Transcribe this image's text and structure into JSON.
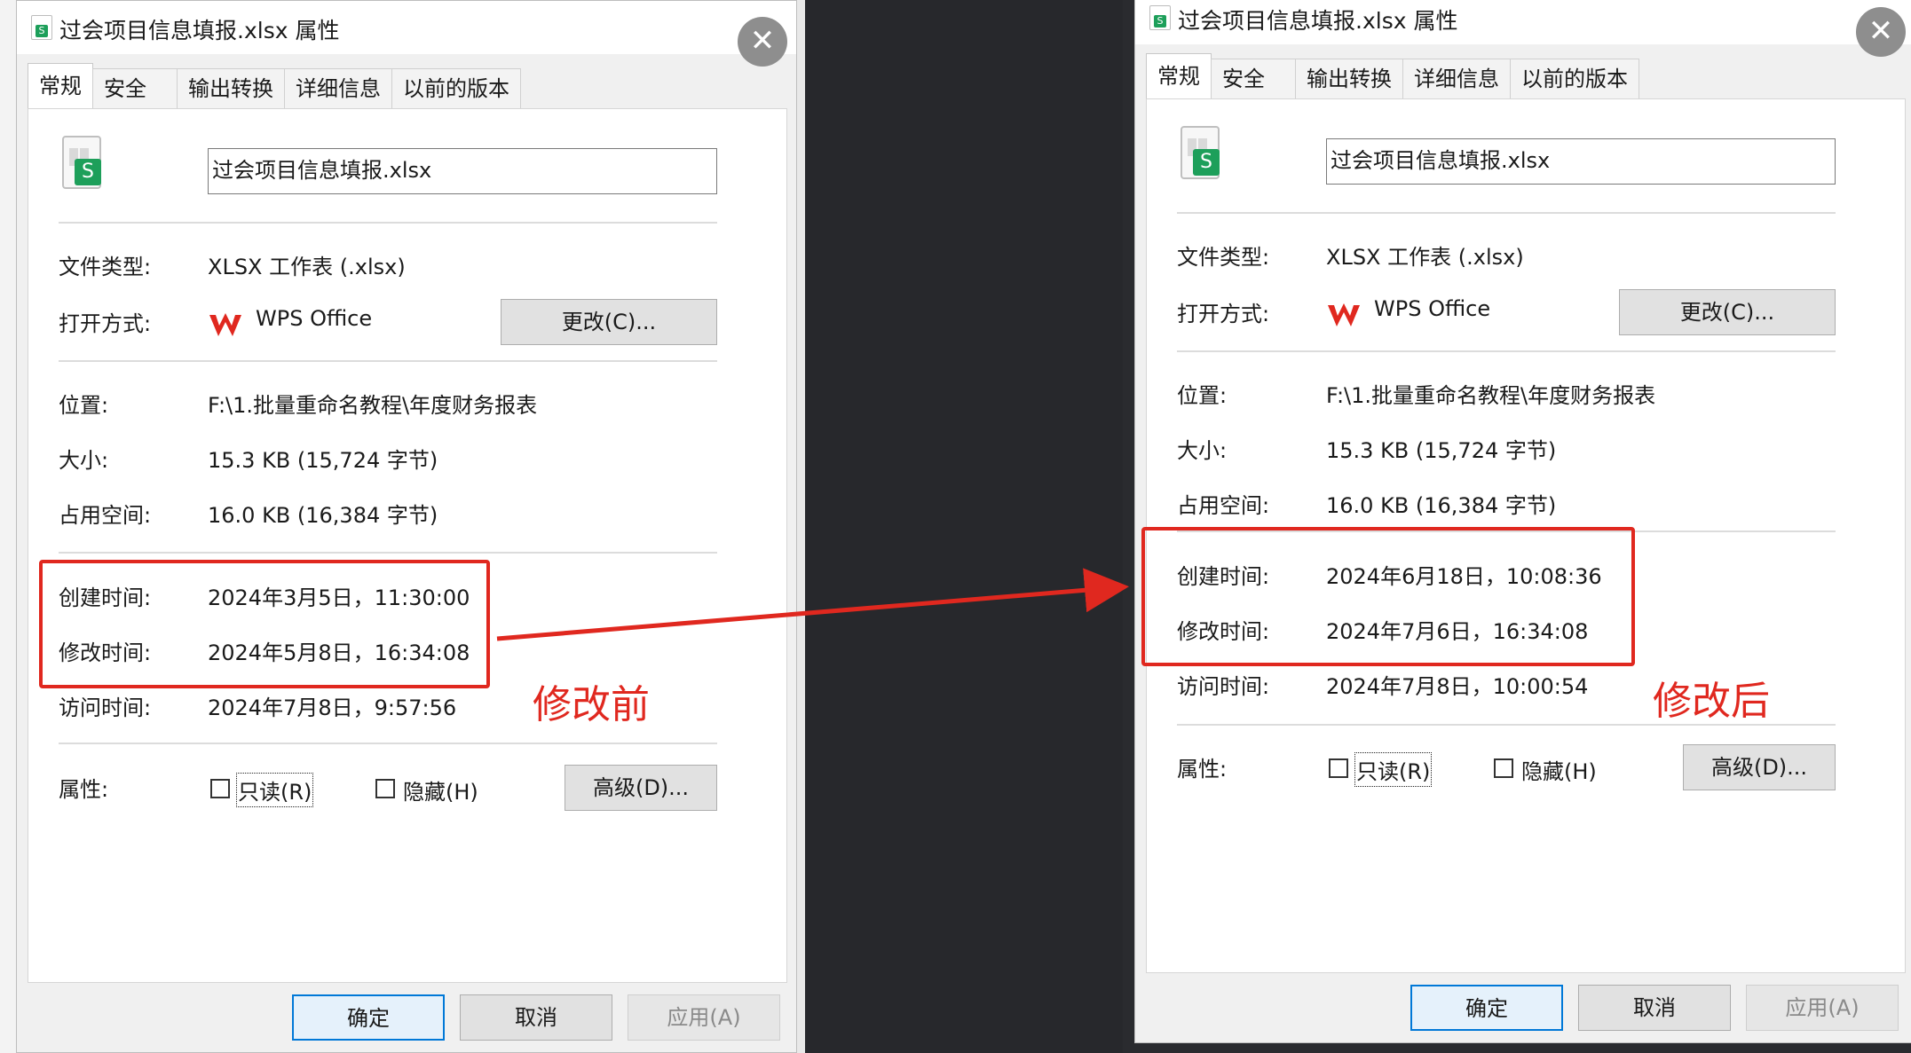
{
  "colors": {
    "annotation_red": "#e0281f",
    "excel_green": "#1d9f5a",
    "wps_red": "#e0281f"
  },
  "icons": {
    "file": "xlsx-file-icon",
    "open_with": "wps-logo-icon",
    "close": "close-icon"
  },
  "dialogs": {
    "before": {
      "title": "过会项目信息填报.xlsx 属性",
      "tabs": [
        "常规",
        "安全",
        "输出转换",
        "详细信息",
        "以前的版本"
      ],
      "filename": "过会项目信息填报.xlsx",
      "file_type_label": "文件类型:",
      "file_type": "XLSX 工作表 (.xlsx)",
      "open_with_label": "打开方式:",
      "open_with": "WPS Office",
      "change_button": "更改(C)...",
      "location_label": "位置:",
      "location": "F:\\1.批量重命名教程\\年度财务报表",
      "size_label": "大小:",
      "size": "15.3 KB (15,724 字节)",
      "disk_size_label": "占用空间:",
      "disk_size": "16.0 KB (16,384 字节)",
      "created_label": "创建时间:",
      "created": "2024年3月5日，11:30:00",
      "modified_label": "修改时间:",
      "modified": "2024年5月8日，16:34:08",
      "accessed_label": "访问时间:",
      "accessed": "2024年7月8日，9:57:56",
      "attributes_label": "属性:",
      "readonly_label": "只读(R)",
      "hidden_label": "隐藏(H)",
      "advanced_button": "高级(D)...",
      "ok_button": "确定",
      "cancel_button": "取消",
      "apply_button": "应用(A)",
      "annotation": "修改前"
    },
    "after": {
      "title": "过会项目信息填报.xlsx 属性",
      "tabs": [
        "常规",
        "安全",
        "输出转换",
        "详细信息",
        "以前的版本"
      ],
      "filename": "过会项目信息填报.xlsx",
      "file_type_label": "文件类型:",
      "file_type": "XLSX 工作表 (.xlsx)",
      "open_with_label": "打开方式:",
      "open_with": "WPS Office",
      "change_button": "更改(C)...",
      "location_label": "位置:",
      "location": "F:\\1.批量重命名教程\\年度财务报表",
      "size_label": "大小:",
      "size": "15.3 KB (15,724 字节)",
      "disk_size_label": "占用空间:",
      "disk_size": "16.0 KB (16,384 字节)",
      "created_label": "创建时间:",
      "created": "2024年6月18日，10:08:36",
      "modified_label": "修改时间:",
      "modified": "2024年7月6日，16:34:08",
      "accessed_label": "访问时间:",
      "accessed": "2024年7月8日，10:00:54",
      "attributes_label": "属性:",
      "readonly_label": "只读(R)",
      "hidden_label": "隐藏(H)",
      "advanced_button": "高级(D)...",
      "ok_button": "确定",
      "cancel_button": "取消",
      "apply_button": "应用(A)",
      "annotation": "修改后"
    }
  }
}
